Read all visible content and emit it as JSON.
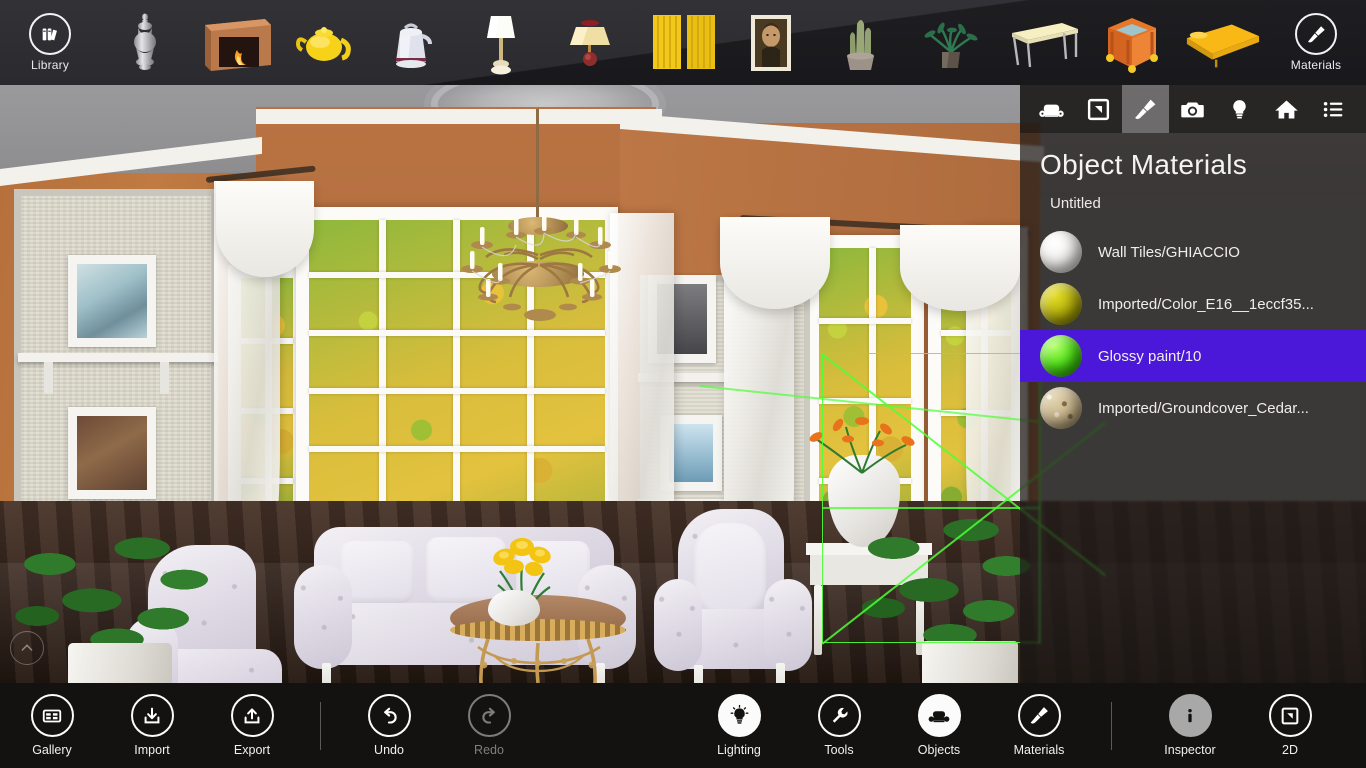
{
  "app": {
    "title": "Interior Design 3D Editor"
  },
  "toolbar": {
    "library": {
      "label": "Library",
      "icon": "library-books-icon"
    },
    "materials": {
      "label": "Materials",
      "icon": "paintbrush-icon"
    },
    "items": [
      {
        "name": "silver-vase",
        "label": "Silver Vase"
      },
      {
        "name": "fireplace",
        "label": "Fireplace"
      },
      {
        "name": "yellow-teapot",
        "label": "Yellow Teapot"
      },
      {
        "name": "watering-can",
        "label": "Watering Can"
      },
      {
        "name": "table-lamp",
        "label": "Table Lamp"
      },
      {
        "name": "wall-sconce",
        "label": "Wall Sconce"
      },
      {
        "name": "yellow-curtains",
        "label": "Curtains"
      },
      {
        "name": "framed-painting",
        "label": "Framed Painting"
      },
      {
        "name": "cactus-plant",
        "label": "Cactus"
      },
      {
        "name": "potted-plant",
        "label": "Potted Plant"
      },
      {
        "name": "white-table",
        "label": "White Table"
      },
      {
        "name": "orange-table",
        "label": "Orange Table"
      },
      {
        "name": "yellow-bed",
        "label": "Yellow Bed"
      }
    ]
  },
  "panel": {
    "title": "Object Materials",
    "subtitle": "Untitled",
    "selection_color": "#4b17d8",
    "tabs": [
      {
        "name": "objects",
        "icon": "sofa-icon",
        "active": false
      },
      {
        "name": "floorplan",
        "icon": "floorplan-icon",
        "active": false
      },
      {
        "name": "materials",
        "icon": "paintbrush-icon",
        "active": true
      },
      {
        "name": "camera",
        "icon": "camera-icon",
        "active": false
      },
      {
        "name": "lighting",
        "icon": "lightbulb-icon",
        "active": false
      },
      {
        "name": "home",
        "icon": "home-icon",
        "active": false
      },
      {
        "name": "list",
        "icon": "list-icon",
        "active": false
      }
    ],
    "materials": [
      {
        "name": "Wall Tiles/GHIACCIO",
        "color": "#f2f1ee",
        "selected": false
      },
      {
        "name": "Imported/Color_E16__1eccf35...",
        "color": "#b3ae08",
        "selected": false
      },
      {
        "name": "Glossy paint/10",
        "color": "#4ee016",
        "selected": true
      },
      {
        "name": "Imported/Groundcover_Cedar...",
        "color": "#c9b48a",
        "selected": false
      }
    ]
  },
  "bottombar": {
    "buttons": [
      {
        "name": "gallery",
        "label": "Gallery",
        "icon": "gallery-icon",
        "style": "outline",
        "enabled": true
      },
      {
        "name": "import",
        "label": "Import",
        "icon": "import-icon",
        "style": "outline",
        "enabled": true
      },
      {
        "name": "export",
        "label": "Export",
        "icon": "export-icon",
        "style": "outline",
        "enabled": true
      },
      {
        "name": "undo",
        "label": "Undo",
        "icon": "undo-icon",
        "style": "outline",
        "enabled": true
      },
      {
        "name": "redo",
        "label": "Redo",
        "icon": "redo-icon",
        "style": "dim",
        "enabled": false
      },
      {
        "name": "lighting",
        "label": "Lighting",
        "icon": "lightbulb-icon",
        "style": "filled",
        "enabled": true
      },
      {
        "name": "tools",
        "label": "Tools",
        "icon": "wrench-icon",
        "style": "outline",
        "enabled": true
      },
      {
        "name": "objects",
        "label": "Objects",
        "icon": "sofa-icon",
        "style": "filled",
        "enabled": true
      },
      {
        "name": "materials",
        "label": "Materials",
        "icon": "paintbrush-icon",
        "style": "outline",
        "enabled": true
      },
      {
        "name": "inspector",
        "label": "Inspector",
        "icon": "info-icon",
        "style": "grey",
        "enabled": true
      },
      {
        "name": "2d",
        "label": "2D",
        "icon": "floorplan-icon",
        "style": "outline",
        "enabled": true
      }
    ]
  },
  "viewport": {
    "collapse_icon": "chevron-up-icon",
    "selection_wire_color": "#4dff36",
    "scene_description": "Living room 3D render with chandelier, sofas, armchairs, coffee table, plants and garden windows"
  }
}
